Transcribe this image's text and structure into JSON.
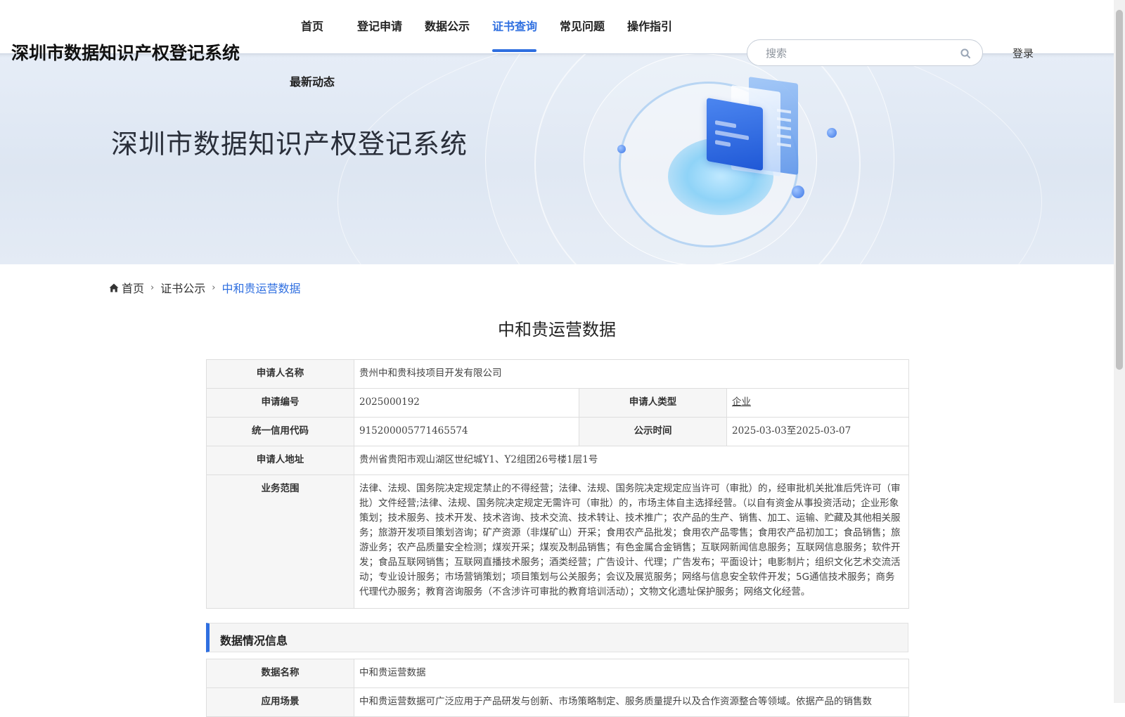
{
  "site": {
    "logo_text": "深圳市数据知识产权登记系统",
    "hero_title": "深圳市数据知识产权登记系统"
  },
  "nav": {
    "items": [
      {
        "label": "首页"
      },
      {
        "label": "登记申请"
      },
      {
        "label": "数据公示"
      },
      {
        "label": "证书查询",
        "active": true
      },
      {
        "label": "常见问题"
      },
      {
        "label": "操作指引"
      },
      {
        "label": "最新动态"
      }
    ],
    "active_color": "#2f6fe0"
  },
  "search": {
    "placeholder": "搜索",
    "value": ""
  },
  "login_label": "登录",
  "breadcrumb": {
    "home": "首页",
    "level2": "证书公示",
    "current": "中和贵运营数据"
  },
  "page_title": "中和贵运营数据",
  "applicant": {
    "name_label": "申请人名称",
    "name": "贵州中和贵科技项目开发有限公司",
    "app_no_label": "申请编号",
    "app_no": "2025000192",
    "type_label": "申请人类型",
    "type": "企业",
    "credit_code_label": "统一信用代码",
    "credit_code": "915200005771465574",
    "publicity_label": "公示时间",
    "publicity_time": "2025-03-03至2025-03-07",
    "address_label": "申请人地址",
    "address": "贵州省贵阳市观山湖区世纪城Y1、Y2组团26号楼1层1号",
    "scope_label": "业务范围",
    "scope": "法律、法规、国务院决定规定禁止的不得经营；法律、法规、国务院决定规定应当许可（审批）的，经审批机关批准后凭许可（审批）文件经营;法律、法规、国务院决定规定无需许可（审批）的，市场主体自主选择经营。（以自有资金从事投资活动；企业形象策划；技术服务、技术开发、技术咨询、技术交流、技术转让、技术推广；农产品的生产、销售、加工、运输、贮藏及其他相关服务；旅游开发项目策划咨询；矿产资源（非煤矿山）开采；食用农产品批发；食用农产品零售；食用农产品初加工；食品销售；旅游业务；农产品质量安全检测；煤炭开采；煤炭及制品销售；有色金属合金销售；互联网新闻信息服务；互联网信息服务；软件开发；食品互联网销售；互联网直播技术服务；酒类经营；广告设计、代理；广告发布；平面设计；电影制片；组织文化艺术交流活动；专业设计服务；市场营销策划；项目策划与公关服务；会议及展览服务；网络与信息安全软件开发；5G通信技术服务；商务代理代办服务；教育咨询服务（不含涉许可审批的教育培训活动）；文物文化遗址保护服务；网络文化经营。"
  },
  "data_section": {
    "title": "数据情况信息",
    "name_label": "数据名称",
    "name": "中和贵运营数据",
    "scenario_label": "应用场景",
    "scenario": "中和贵运营数据可广泛应用于产品研发与创新、市场策略制定、服务质量提升以及合作资源整合等领域。依据产品的销售数"
  },
  "icons": {
    "search": "magnifier-icon",
    "home": "home-icon",
    "breadcrumb_separator": "chevron-right-icon"
  }
}
